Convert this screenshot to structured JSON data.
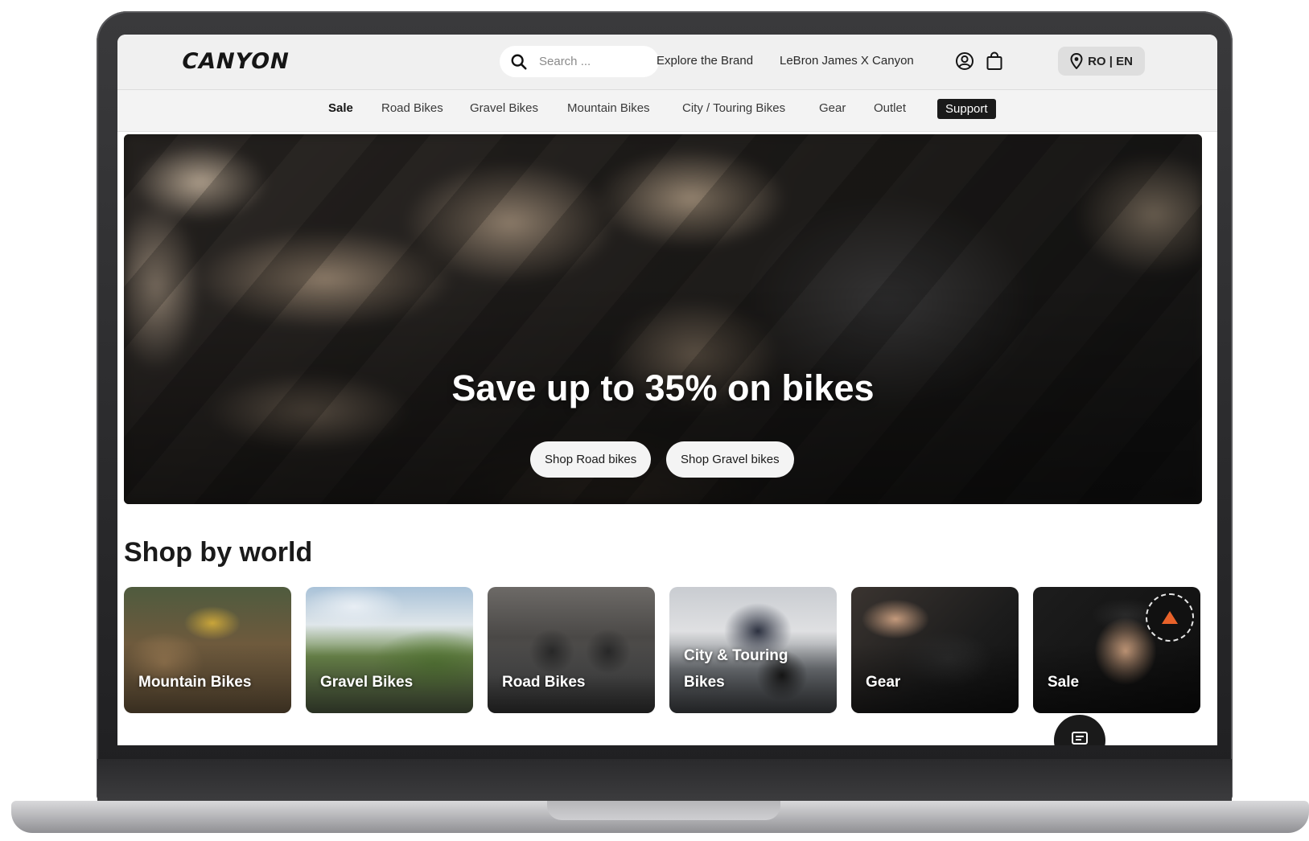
{
  "header": {
    "logo_text": "CANYON",
    "search": {
      "placeholder": "Search ..."
    },
    "links": [
      "Explore the Brand",
      "LeBron James X Canyon"
    ],
    "icons": [
      "account-icon",
      "cart-icon",
      "location-pin-icon"
    ],
    "region_label": "RO | EN"
  },
  "nav": {
    "items": [
      "Sale",
      "Road Bikes",
      "Gravel Bikes",
      "Mountain Bikes",
      "City / Touring Bikes",
      "Gear",
      "Outlet",
      "Support"
    ]
  },
  "hero": {
    "title": "Save up to 35% on bikes",
    "buttons": [
      "Shop Road bikes",
      "Shop Gravel bikes"
    ]
  },
  "shop_by_world": {
    "title": "Shop by world",
    "cards": [
      "Mountain Bikes",
      "Gravel Bikes",
      "Road Bikes",
      "City & Touring Bikes",
      "Gear",
      "Sale"
    ]
  },
  "chat": {
    "icon": "chat-icon"
  },
  "colors": {
    "header_bg": "#f0f0f0",
    "support_bg": "#1a1a1a",
    "sale_badge_accent": "#e8622a"
  }
}
